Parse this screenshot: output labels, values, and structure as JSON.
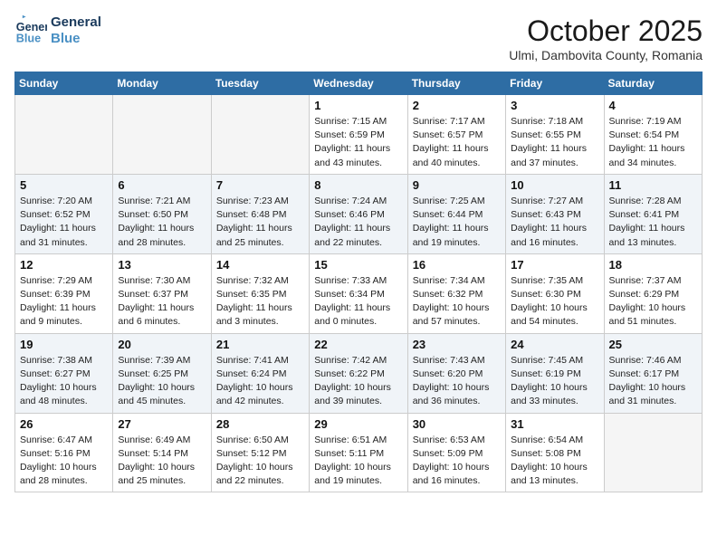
{
  "header": {
    "logo_line1": "General",
    "logo_line2": "Blue",
    "month": "October 2025",
    "location": "Ulmi, Dambovita County, Romania"
  },
  "weekdays": [
    "Sunday",
    "Monday",
    "Tuesday",
    "Wednesday",
    "Thursday",
    "Friday",
    "Saturday"
  ],
  "weeks": [
    [
      {
        "day": "",
        "info": ""
      },
      {
        "day": "",
        "info": ""
      },
      {
        "day": "",
        "info": ""
      },
      {
        "day": "1",
        "info": "Sunrise: 7:15 AM\nSunset: 6:59 PM\nDaylight: 11 hours\nand 43 minutes."
      },
      {
        "day": "2",
        "info": "Sunrise: 7:17 AM\nSunset: 6:57 PM\nDaylight: 11 hours\nand 40 minutes."
      },
      {
        "day": "3",
        "info": "Sunrise: 7:18 AM\nSunset: 6:55 PM\nDaylight: 11 hours\nand 37 minutes."
      },
      {
        "day": "4",
        "info": "Sunrise: 7:19 AM\nSunset: 6:54 PM\nDaylight: 11 hours\nand 34 minutes."
      }
    ],
    [
      {
        "day": "5",
        "info": "Sunrise: 7:20 AM\nSunset: 6:52 PM\nDaylight: 11 hours\nand 31 minutes."
      },
      {
        "day": "6",
        "info": "Sunrise: 7:21 AM\nSunset: 6:50 PM\nDaylight: 11 hours\nand 28 minutes."
      },
      {
        "day": "7",
        "info": "Sunrise: 7:23 AM\nSunset: 6:48 PM\nDaylight: 11 hours\nand 25 minutes."
      },
      {
        "day": "8",
        "info": "Sunrise: 7:24 AM\nSunset: 6:46 PM\nDaylight: 11 hours\nand 22 minutes."
      },
      {
        "day": "9",
        "info": "Sunrise: 7:25 AM\nSunset: 6:44 PM\nDaylight: 11 hours\nand 19 minutes."
      },
      {
        "day": "10",
        "info": "Sunrise: 7:27 AM\nSunset: 6:43 PM\nDaylight: 11 hours\nand 16 minutes."
      },
      {
        "day": "11",
        "info": "Sunrise: 7:28 AM\nSunset: 6:41 PM\nDaylight: 11 hours\nand 13 minutes."
      }
    ],
    [
      {
        "day": "12",
        "info": "Sunrise: 7:29 AM\nSunset: 6:39 PM\nDaylight: 11 hours\nand 9 minutes."
      },
      {
        "day": "13",
        "info": "Sunrise: 7:30 AM\nSunset: 6:37 PM\nDaylight: 11 hours\nand 6 minutes."
      },
      {
        "day": "14",
        "info": "Sunrise: 7:32 AM\nSunset: 6:35 PM\nDaylight: 11 hours\nand 3 minutes."
      },
      {
        "day": "15",
        "info": "Sunrise: 7:33 AM\nSunset: 6:34 PM\nDaylight: 11 hours\nand 0 minutes."
      },
      {
        "day": "16",
        "info": "Sunrise: 7:34 AM\nSunset: 6:32 PM\nDaylight: 10 hours\nand 57 minutes."
      },
      {
        "day": "17",
        "info": "Sunrise: 7:35 AM\nSunset: 6:30 PM\nDaylight: 10 hours\nand 54 minutes."
      },
      {
        "day": "18",
        "info": "Sunrise: 7:37 AM\nSunset: 6:29 PM\nDaylight: 10 hours\nand 51 minutes."
      }
    ],
    [
      {
        "day": "19",
        "info": "Sunrise: 7:38 AM\nSunset: 6:27 PM\nDaylight: 10 hours\nand 48 minutes."
      },
      {
        "day": "20",
        "info": "Sunrise: 7:39 AM\nSunset: 6:25 PM\nDaylight: 10 hours\nand 45 minutes."
      },
      {
        "day": "21",
        "info": "Sunrise: 7:41 AM\nSunset: 6:24 PM\nDaylight: 10 hours\nand 42 minutes."
      },
      {
        "day": "22",
        "info": "Sunrise: 7:42 AM\nSunset: 6:22 PM\nDaylight: 10 hours\nand 39 minutes."
      },
      {
        "day": "23",
        "info": "Sunrise: 7:43 AM\nSunset: 6:20 PM\nDaylight: 10 hours\nand 36 minutes."
      },
      {
        "day": "24",
        "info": "Sunrise: 7:45 AM\nSunset: 6:19 PM\nDaylight: 10 hours\nand 33 minutes."
      },
      {
        "day": "25",
        "info": "Sunrise: 7:46 AM\nSunset: 6:17 PM\nDaylight: 10 hours\nand 31 minutes."
      }
    ],
    [
      {
        "day": "26",
        "info": "Sunrise: 6:47 AM\nSunset: 5:16 PM\nDaylight: 10 hours\nand 28 minutes."
      },
      {
        "day": "27",
        "info": "Sunrise: 6:49 AM\nSunset: 5:14 PM\nDaylight: 10 hours\nand 25 minutes."
      },
      {
        "day": "28",
        "info": "Sunrise: 6:50 AM\nSunset: 5:12 PM\nDaylight: 10 hours\nand 22 minutes."
      },
      {
        "day": "29",
        "info": "Sunrise: 6:51 AM\nSunset: 5:11 PM\nDaylight: 10 hours\nand 19 minutes."
      },
      {
        "day": "30",
        "info": "Sunrise: 6:53 AM\nSunset: 5:09 PM\nDaylight: 10 hours\nand 16 minutes."
      },
      {
        "day": "31",
        "info": "Sunrise: 6:54 AM\nSunset: 5:08 PM\nDaylight: 10 hours\nand 13 minutes."
      },
      {
        "day": "",
        "info": ""
      }
    ]
  ]
}
